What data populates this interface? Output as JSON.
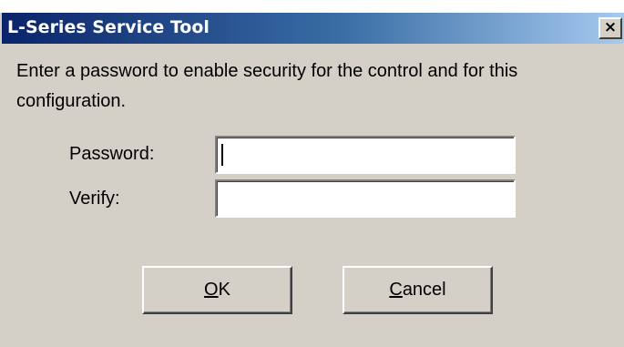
{
  "window": {
    "title": "L-Series Service Tool",
    "close_glyph": "×"
  },
  "message": {
    "text": "Enter a password to enable security for the control and for this configuration."
  },
  "form": {
    "password_label": "Password:",
    "password_value": "",
    "verify_label": "Verify:",
    "verify_value": ""
  },
  "buttons": {
    "ok": {
      "mnemonic": "O",
      "rest": "K"
    },
    "cancel": {
      "mnemonic": "C",
      "rest": "ancel"
    }
  }
}
